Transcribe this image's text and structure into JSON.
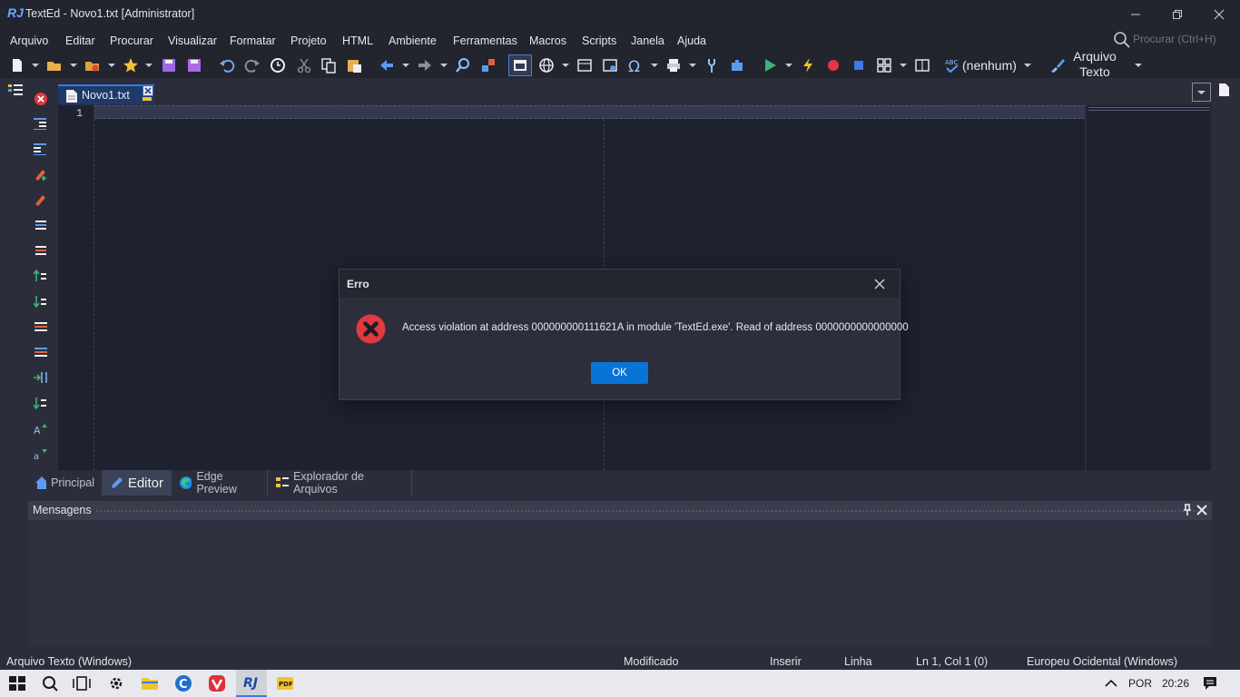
{
  "window": {
    "title": "TextEd - Novo1.txt [Administrator]",
    "logo": "RJ",
    "controls": [
      "minimize-icon",
      "restore-icon",
      "close-icon"
    ]
  },
  "menu": {
    "items": [
      "Arquivo",
      "Editar",
      "Procurar",
      "Visualizar",
      "Formatar",
      "Projeto",
      "HTML",
      "Ambiente",
      "Ferramentas",
      "Macros",
      "Scripts",
      "Janela",
      "Ajuda"
    ],
    "search_placeholder": "Procurar (Ctrl+H)"
  },
  "toolbar": {
    "syntax_value": "(nenhum)",
    "filetype_value": "Arquivo Texto"
  },
  "tabs": {
    "document": "Novo1.txt"
  },
  "editor": {
    "line_number": "1"
  },
  "view_tabs": [
    "Principal",
    "Editor",
    "Edge Preview",
    "Explorador de Arquivos"
  ],
  "messages": {
    "title": "Mensagens"
  },
  "status": {
    "file_type": "Arquivo Texto (Windows)",
    "modified": "Modificado",
    "insert_mode": "Inserir",
    "line_mode": "Linha",
    "position": "Ln 1, Col 1 (0)",
    "encoding": "Europeu Ocidental (Windows)"
  },
  "taskbar": {
    "language": "POR",
    "time": "20:26"
  },
  "dialog": {
    "title": "Erro",
    "message": "Access violation at address 000000000111621A in module 'TextEd.exe'. Read of address 0000000000000000",
    "ok_label": "OK"
  },
  "colors": {
    "accent": "#0a74d6",
    "error": "#e03a3e",
    "editor_bg": "#1e2230"
  }
}
